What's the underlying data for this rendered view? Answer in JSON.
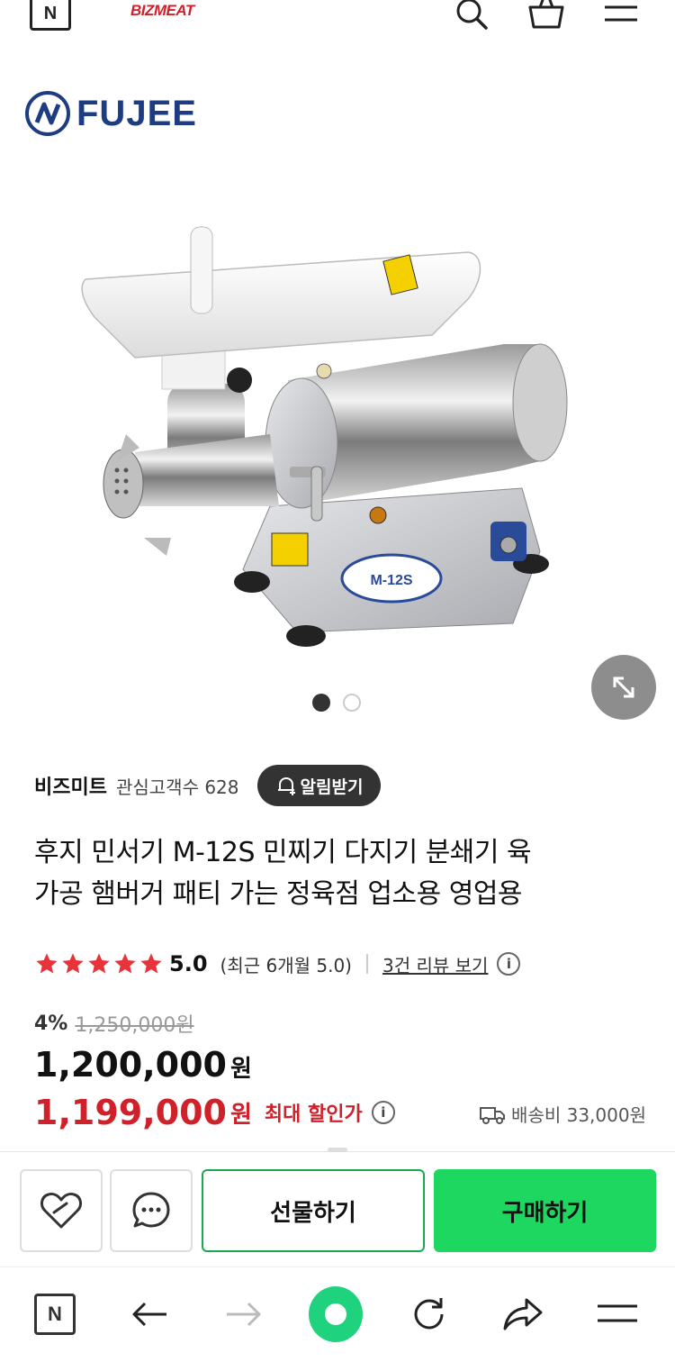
{
  "header": {
    "n_label": "N",
    "store_logo": "BIZMEAT",
    "icons": [
      "search-icon",
      "cart-icon",
      "menu-icon"
    ]
  },
  "gallery": {
    "brand_logo": "FUJEE",
    "slide_total": 2,
    "slide_current": 1,
    "expand_icon": "expand-icon"
  },
  "seller": {
    "name": "비즈미트",
    "follower_text": "관심고객수 628",
    "alarm_label": "알림받기"
  },
  "product": {
    "title_line1": "후지 민서기 M-12S 민찌기 다지기 분쇄기 육",
    "title_line2": "가공 햄버거 패티 가는 정육점 업소용 영업용"
  },
  "rating": {
    "stars": 5,
    "value": "5.0",
    "recent": "(최근 6개월 5.0)",
    "review_link": "3건 리뷰 보기"
  },
  "price": {
    "discount": "4%",
    "original": "1,250,000원",
    "sale": "1,200,000",
    "sale_unit": "원",
    "max_discount": "1,199,000",
    "max_unit": "원",
    "max_label": "최대 할인가",
    "shipping": "배송비 33,000원"
  },
  "actions": {
    "gift_label": "선물하기",
    "buy_label": "구매하기"
  },
  "bottom_nav": {
    "n_label": "N"
  },
  "colors": {
    "accent_green": "#1ed760",
    "sale_red": "#d0202a",
    "brand_blue": "#1e3c82"
  }
}
